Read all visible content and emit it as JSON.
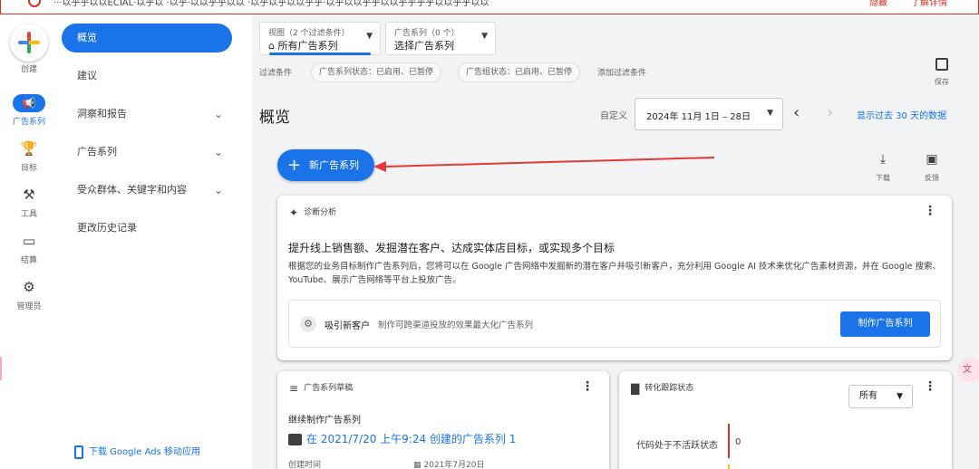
{
  "alert": {
    "text": "···以乎乎以以ECIAL·以乎以 ·以乎·以以乎乎以以 ·以乎以乎以以乎乎·以乎以以乎乎以以乎乎乎乎以以乎乎以以",
    "action1": "隐藏",
    "action2": "了解详情"
  },
  "rail": {
    "create_label": "创建",
    "items": [
      {
        "label": "广告系列",
        "icon": "megaphone-icon"
      },
      {
        "label": "目标",
        "icon": "trophy-icon"
      },
      {
        "label": "工具",
        "icon": "tools-icon"
      },
      {
        "label": "结算",
        "icon": "credit-card-icon"
      },
      {
        "label": "管理员",
        "icon": "gear-icon"
      }
    ]
  },
  "nav": {
    "items": [
      {
        "label": "概览"
      },
      {
        "label": "建议"
      },
      {
        "label": "洞察和报告"
      },
      {
        "label": "广告系列"
      },
      {
        "label": "受众群体、关键字和内容"
      },
      {
        "label": "更改历史记录"
      }
    ],
    "footer": "下载 Google Ads 移动应用"
  },
  "filters": {
    "view_small": "视图（2 个过滤条件）",
    "view_main": "所有广告系列",
    "campaign_small": "广告系列（0 个）",
    "campaign_main": "选择广告系列",
    "label": "过滤条件",
    "chips": [
      "广告系列状态：已启用、已暂停",
      "广告组状态：已启用、已暂停"
    ],
    "add": "添加过滤条件",
    "save": "保存"
  },
  "header": {
    "title": "概览",
    "custom": "自定义",
    "date_range": "2024年 11月 1日 – 28日",
    "show_30": "显示过去 30 天的数据"
  },
  "actions": {
    "new_campaign": "新广告系列",
    "download": "下载",
    "feedback": "反馈"
  },
  "diagnosis": {
    "header": "诊断分析",
    "title": "提升线上销售额、发掘潜在客户、达成实体店目标，或实现多个目标",
    "body": "根据您的业务目标制作广告系列后，您将可以在 Google 广告网络中发掘新的潜在客户并吸引新客户，充分利用 Google AI 技术来优化广告素材资源，并在 Google 搜索、YouTube、展示广告网络等平台上投放广告。",
    "goal_name": "吸引新客户",
    "goal_desc": "制作可跨渠道投放的效果最大化广告系列",
    "goal_button": "制作广告系列"
  },
  "drafts": {
    "header": "广告系列草稿",
    "continue": "继续制作广告系列",
    "link": "在 2021/7/20 上午9:24 创建的广告系列 1",
    "created_label": "创建时间",
    "created_date": "2021年7月20日"
  },
  "conversion": {
    "header": "转化跟踪状态",
    "filter": "所有",
    "inactive_label": "代码处于不活跃状态",
    "inactive_value": "0"
  },
  "colors": {
    "primary": "#1a73e8",
    "alert": "#d93025",
    "arrow": "#e53935"
  }
}
